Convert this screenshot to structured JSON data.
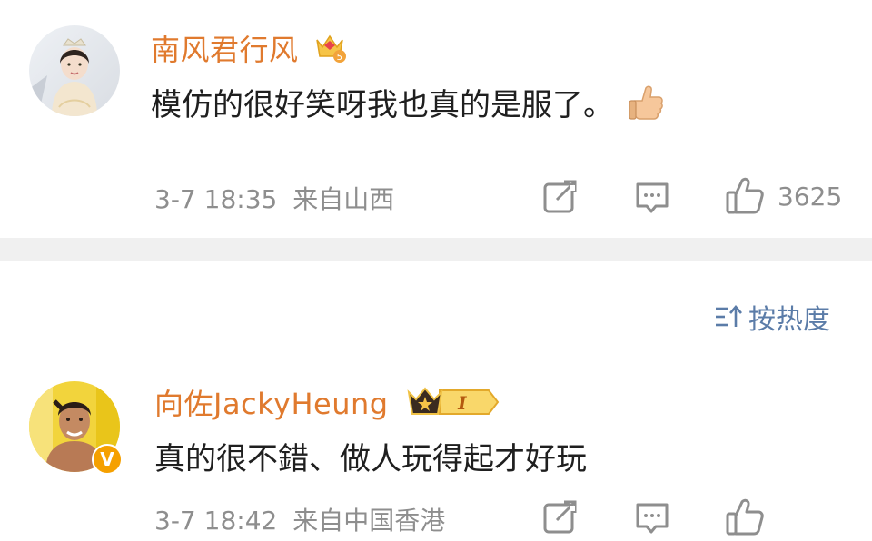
{
  "comments": [
    {
      "username": "南风君行风",
      "text": "模仿的很好笑呀我也真的是服了。",
      "timestamp": "3-7 18:35",
      "location": "来自山西",
      "like_count": "3625",
      "badge_level": "5"
    },
    {
      "username": "向佐JackyHeung",
      "text": "真的很不錯、做人玩得起才好玩",
      "timestamp": "3-7 18:42",
      "location": "来自中国香港",
      "badge_level": "I",
      "verified_mark": "V"
    }
  ],
  "sort": {
    "label": "按热度"
  },
  "colors": {
    "username": "#e07a2e",
    "meta": "#8e8e8e",
    "sort_link": "#5b7ca8",
    "divider": "#f0f0f0",
    "verified": "#f5a000"
  },
  "icons": {
    "share": "share-icon",
    "comment": "comment-icon",
    "like": "thumbs-up-icon",
    "sort": "sort-icon",
    "thumbs_emoji": "thumbs-up-emoji"
  }
}
